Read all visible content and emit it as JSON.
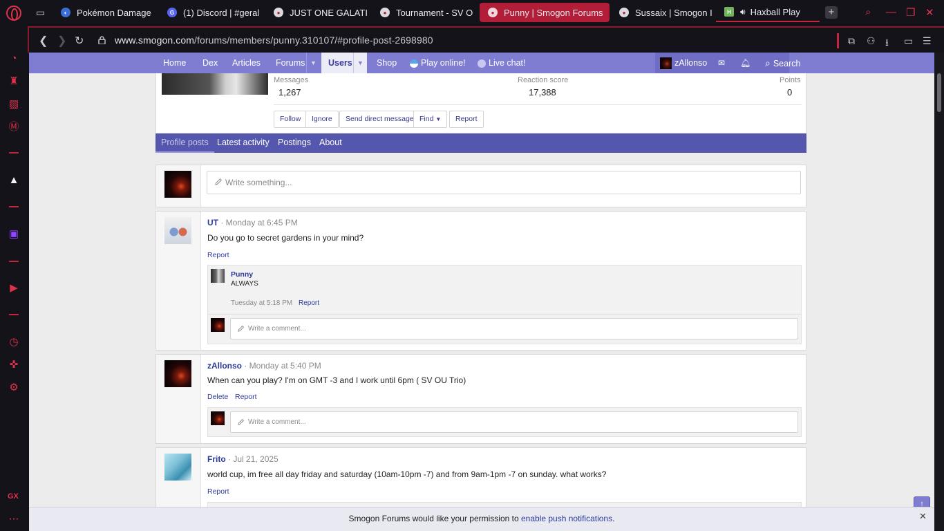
{
  "browser": {
    "tabs": [
      {
        "title": "Pokémon Damage",
        "active": false,
        "favicon": "pokemon-damage-icon"
      },
      {
        "title": "(1) Discord | #geral",
        "active": false,
        "favicon": "discord-icon"
      },
      {
        "title": "JUST ONE GALATI",
        "active": false,
        "favicon": "smogon-icon"
      },
      {
        "title": "Tournament - SV O",
        "active": false,
        "favicon": "smogon-icon"
      },
      {
        "title": "Punny | Smogon Forums",
        "active": true,
        "favicon": "smogon-icon"
      },
      {
        "title": "Sussaix | Smogon I",
        "active": false,
        "favicon": "smogon-icon"
      },
      {
        "title": "Haxball Play",
        "active": false,
        "favicon": "haxball-icon"
      }
    ],
    "haxball_letter": "H",
    "url_host": "www.smogon.com",
    "url_path": "/forums/members/punny.310107/#profile-post-2698980",
    "accent_color": "#e0324b"
  },
  "forum_nav": {
    "items": [
      "Home",
      "Dex",
      "Articles",
      "Forums",
      "Users",
      "Shop",
      "Play online!",
      "Live chat!"
    ],
    "selected": "Users",
    "user": "zAllonso",
    "search": "Search",
    "nav_color": "#7e7dd1"
  },
  "profile": {
    "stats": [
      {
        "label": "Messages",
        "value": "1,267"
      },
      {
        "label": "Reaction score",
        "value": "17,388"
      },
      {
        "label": "Points",
        "value": "0"
      }
    ],
    "buttons": [
      "Follow",
      "Ignore",
      "Send direct message",
      "Find",
      "Report"
    ],
    "tabs": [
      "Profile posts",
      "Latest activity",
      "Postings",
      "About"
    ],
    "write_placeholder": "Write something..."
  },
  "posts": [
    {
      "author": "UT",
      "meta": "· Monday at 6:45 PM",
      "body": "Do you go to secret gardens in your mind?",
      "actions": [
        "Report"
      ],
      "comments": [
        {
          "author": "Punny",
          "text": "ALWAYS",
          "meta": "Tuesday at 5:18 PM",
          "action": "Report"
        }
      ],
      "comment_placeholder": "Write a comment..."
    },
    {
      "author": "zAllonso",
      "meta": "· Monday at 5:40 PM",
      "body": "When can you play? I'm on GMT -3 and I work until 6pm ( SV OU Trio)",
      "actions": [
        "Delete",
        "Report"
      ],
      "comment_placeholder": "Write a comment..."
    },
    {
      "author": "Frito",
      "meta": "· Jul 21, 2025",
      "body": "world cup, im free all day friday and saturday (10am-10pm -7) and from 9am-1pm -7 on sunday. what works?",
      "actions": [
        "Report"
      ]
    }
  ],
  "notice": {
    "prefix": "Smogon Forums would like your permission to",
    "link": "enable push notifications",
    "suffix": "."
  },
  "sidebar": {
    "gx": "GX"
  }
}
